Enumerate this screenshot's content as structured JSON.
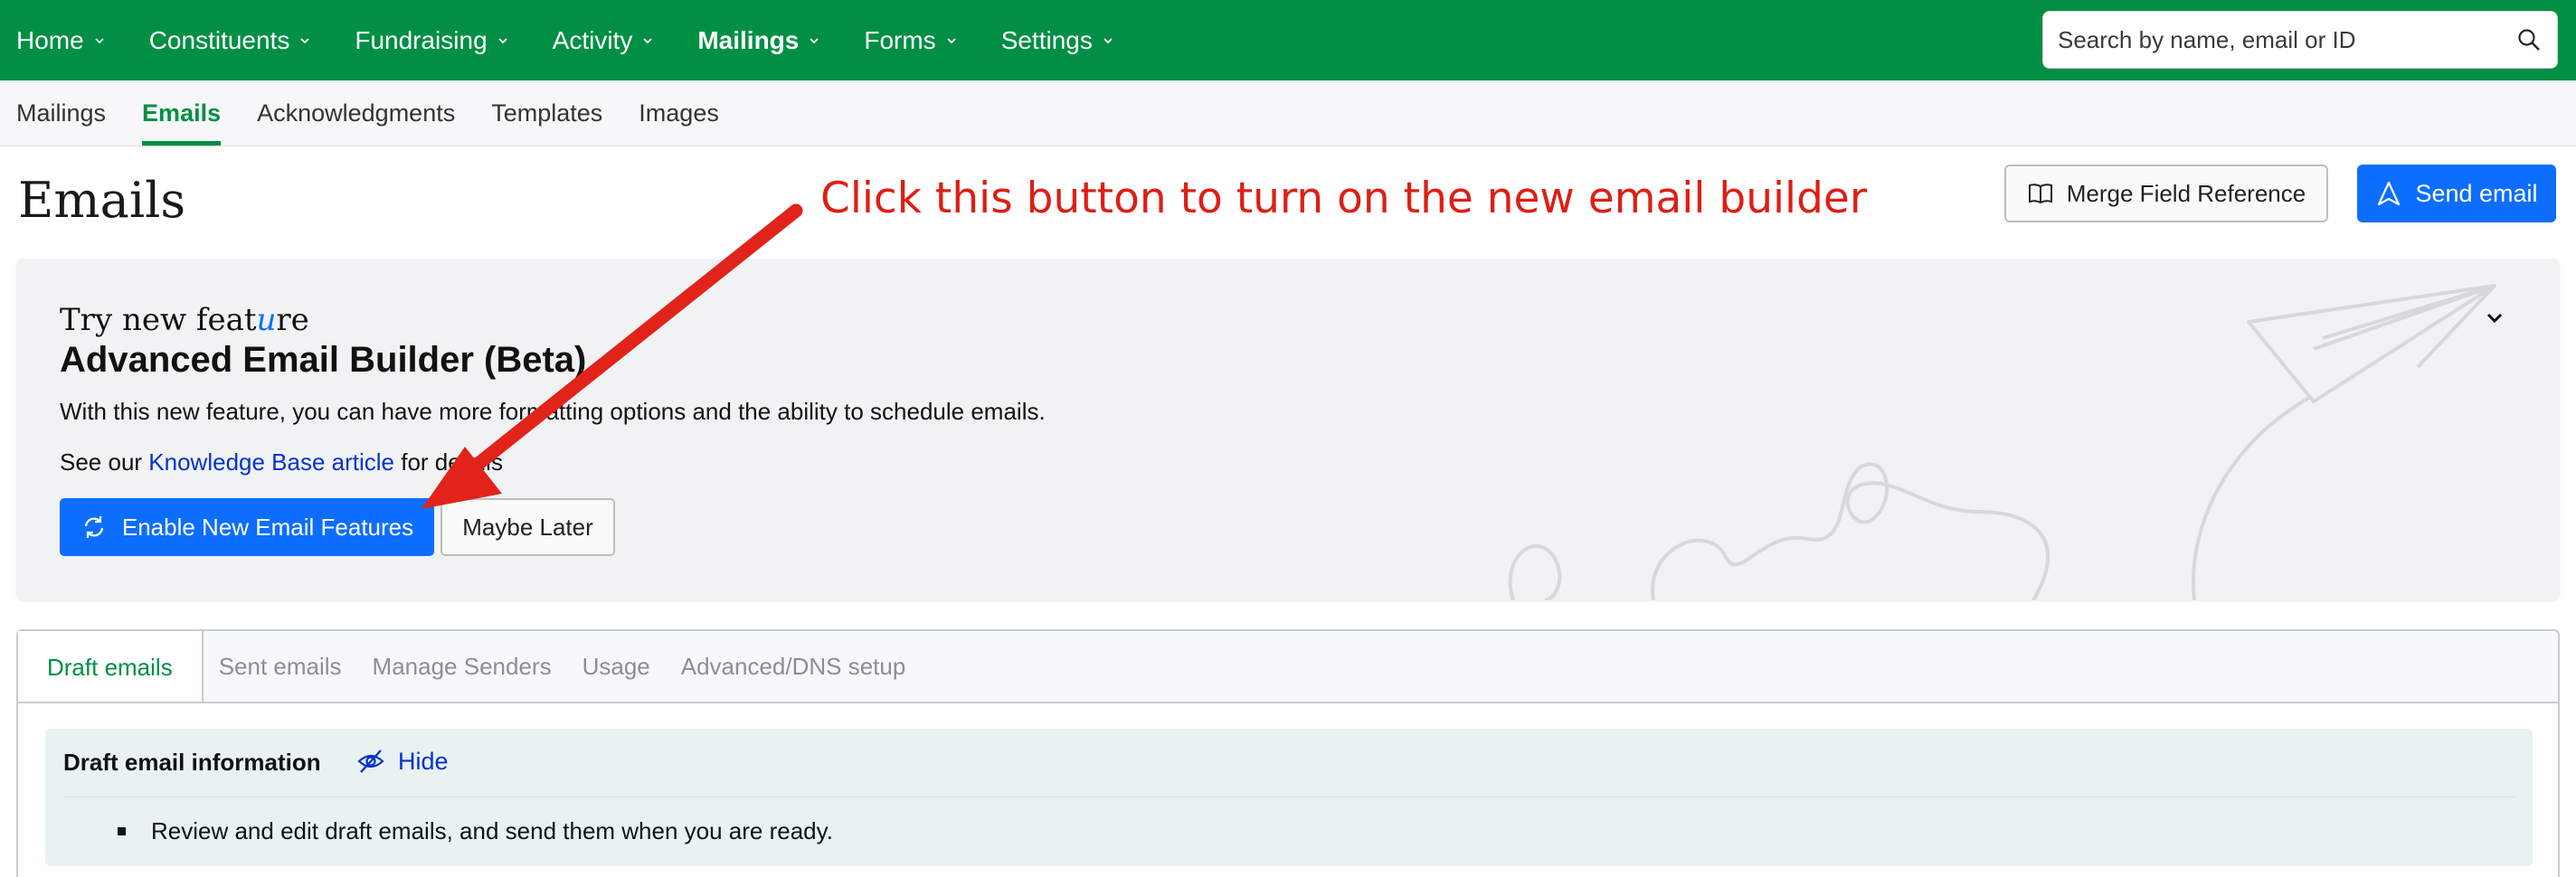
{
  "topnav": {
    "items": [
      {
        "label": "Home"
      },
      {
        "label": "Constituents"
      },
      {
        "label": "Fundraising"
      },
      {
        "label": "Activity"
      },
      {
        "label": "Mailings",
        "active": true
      },
      {
        "label": "Forms"
      },
      {
        "label": "Settings"
      }
    ],
    "search": {
      "placeholder": "Search by name, email or ID",
      "value": ""
    },
    "bg_color": "#008f44"
  },
  "subnav": {
    "items": [
      {
        "label": "Mailings"
      },
      {
        "label": "Emails",
        "active": true
      },
      {
        "label": "Acknowledgments"
      },
      {
        "label": "Templates"
      },
      {
        "label": "Images"
      }
    ]
  },
  "page": {
    "title": "Emails",
    "merge_button": "Merge Field Reference",
    "send_button": "Send email"
  },
  "annotation": {
    "text": "Click this button to turn on the new email builder",
    "color": "#dd1f15"
  },
  "feature": {
    "try_prefix": "Try new feat",
    "try_u": "u",
    "try_suffix": "re",
    "title": "Advanced Email Builder (Beta)",
    "description": "With this new feature, you can have more formatting options and the ability to schedule emails.",
    "kb_prefix": "See our ",
    "kb_link": "Knowledge Base article",
    "kb_suffix": " for details",
    "enable_button": "Enable New Email Features",
    "later_button": "Maybe Later"
  },
  "tabs": {
    "items": [
      {
        "label": "Draft emails",
        "active": true
      },
      {
        "label": "Sent emails"
      },
      {
        "label": "Manage Senders"
      },
      {
        "label": "Usage"
      },
      {
        "label": "Advanced/DNS setup"
      }
    ]
  },
  "info": {
    "title": "Draft email information",
    "hide_label": "Hide",
    "bullets": [
      "Review and edit draft emails, and send them when you are ready."
    ]
  },
  "colors": {
    "brand_green": "#008f44",
    "primary_blue": "#0d6efd",
    "link_blue": "#0033cc"
  }
}
